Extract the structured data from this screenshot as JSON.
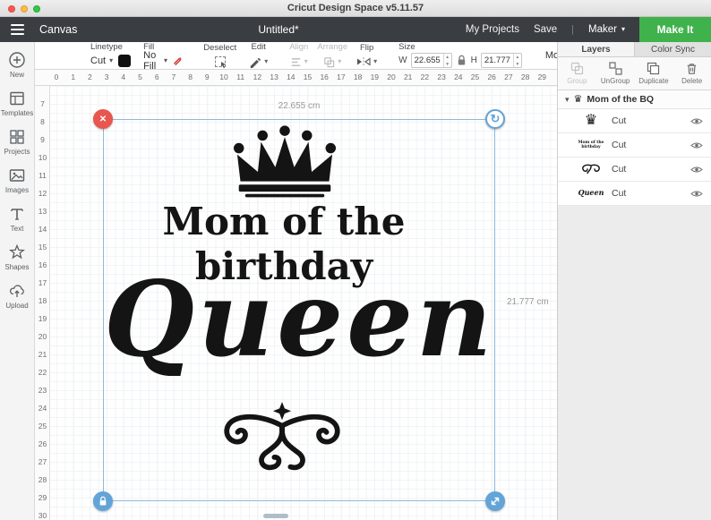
{
  "titlebar": {
    "title": "Cricut Design Space  v5.11.57"
  },
  "header": {
    "canvas": "Canvas",
    "doc_title": "Untitled*",
    "my_projects": "My Projects",
    "save": "Save",
    "divider": "|",
    "machine": "Maker",
    "make_it": "Make It"
  },
  "toolbar": {
    "linetype_label": "Linetype",
    "linetype_value": "Cut",
    "fill_label": "Fill",
    "fill_value": "No Fill",
    "deselect": "Deselect",
    "edit": "Edit",
    "align": "Align",
    "arrange": "Arrange",
    "flip": "Flip",
    "size_label": "Size",
    "w_label": "W",
    "w_value": "22.655",
    "h_label": "H",
    "h_value": "21.777",
    "more": "More"
  },
  "sidebar": {
    "items": [
      {
        "label": "New"
      },
      {
        "label": "Templates"
      },
      {
        "label": "Projects"
      },
      {
        "label": "Images"
      },
      {
        "label": "Text"
      },
      {
        "label": "Shapes"
      },
      {
        "label": "Upload"
      }
    ]
  },
  "canvas": {
    "h_ruler": [
      "0",
      "1",
      "2",
      "3",
      "4",
      "5",
      "6",
      "7",
      "8",
      "9",
      "10",
      "11",
      "12",
      "13",
      "14",
      "15",
      "16",
      "17",
      "18",
      "19",
      "20",
      "21",
      "22",
      "23",
      "24",
      "25",
      "26",
      "27",
      "28",
      "29"
    ],
    "v_ruler": [
      "7",
      "8",
      "9",
      "10",
      "11",
      "12",
      "13",
      "14",
      "15",
      "16",
      "17",
      "18",
      "19",
      "20",
      "21",
      "22",
      "23",
      "24",
      "25",
      "26",
      "27",
      "28",
      "29",
      "30"
    ],
    "selection": {
      "width_label": "22.655 cm",
      "height_label": "21.777 cm"
    },
    "design": {
      "line1": "Mom of the",
      "line2": "birthday",
      "line3": "Queen"
    }
  },
  "layers_panel": {
    "tabs": [
      {
        "label": "Layers"
      },
      {
        "label": "Color Sync"
      }
    ],
    "actions": [
      {
        "label": "Group"
      },
      {
        "label": "UnGroup"
      },
      {
        "label": "Duplicate"
      },
      {
        "label": "Delete"
      }
    ],
    "group": {
      "name": "Mom of the BQ",
      "layers": [
        {
          "op": "Cut",
          "thumb_text": ""
        },
        {
          "op": "Cut",
          "thumb_text": "Mom of the birthday"
        },
        {
          "op": "Cut",
          "thumb_text": ""
        },
        {
          "op": "Cut",
          "thumb_text": "Queen"
        }
      ]
    }
  },
  "icons": {
    "chevron_down": "▾",
    "close_x": "✕",
    "rotate": "↻",
    "crown": "♛",
    "disclosure": "▾"
  },
  "colors": {
    "make_it_green": "#3fb24b",
    "selection_blue": "#8fb9da",
    "handle_red": "#e8564f",
    "handle_blue": "#62a4d8"
  }
}
